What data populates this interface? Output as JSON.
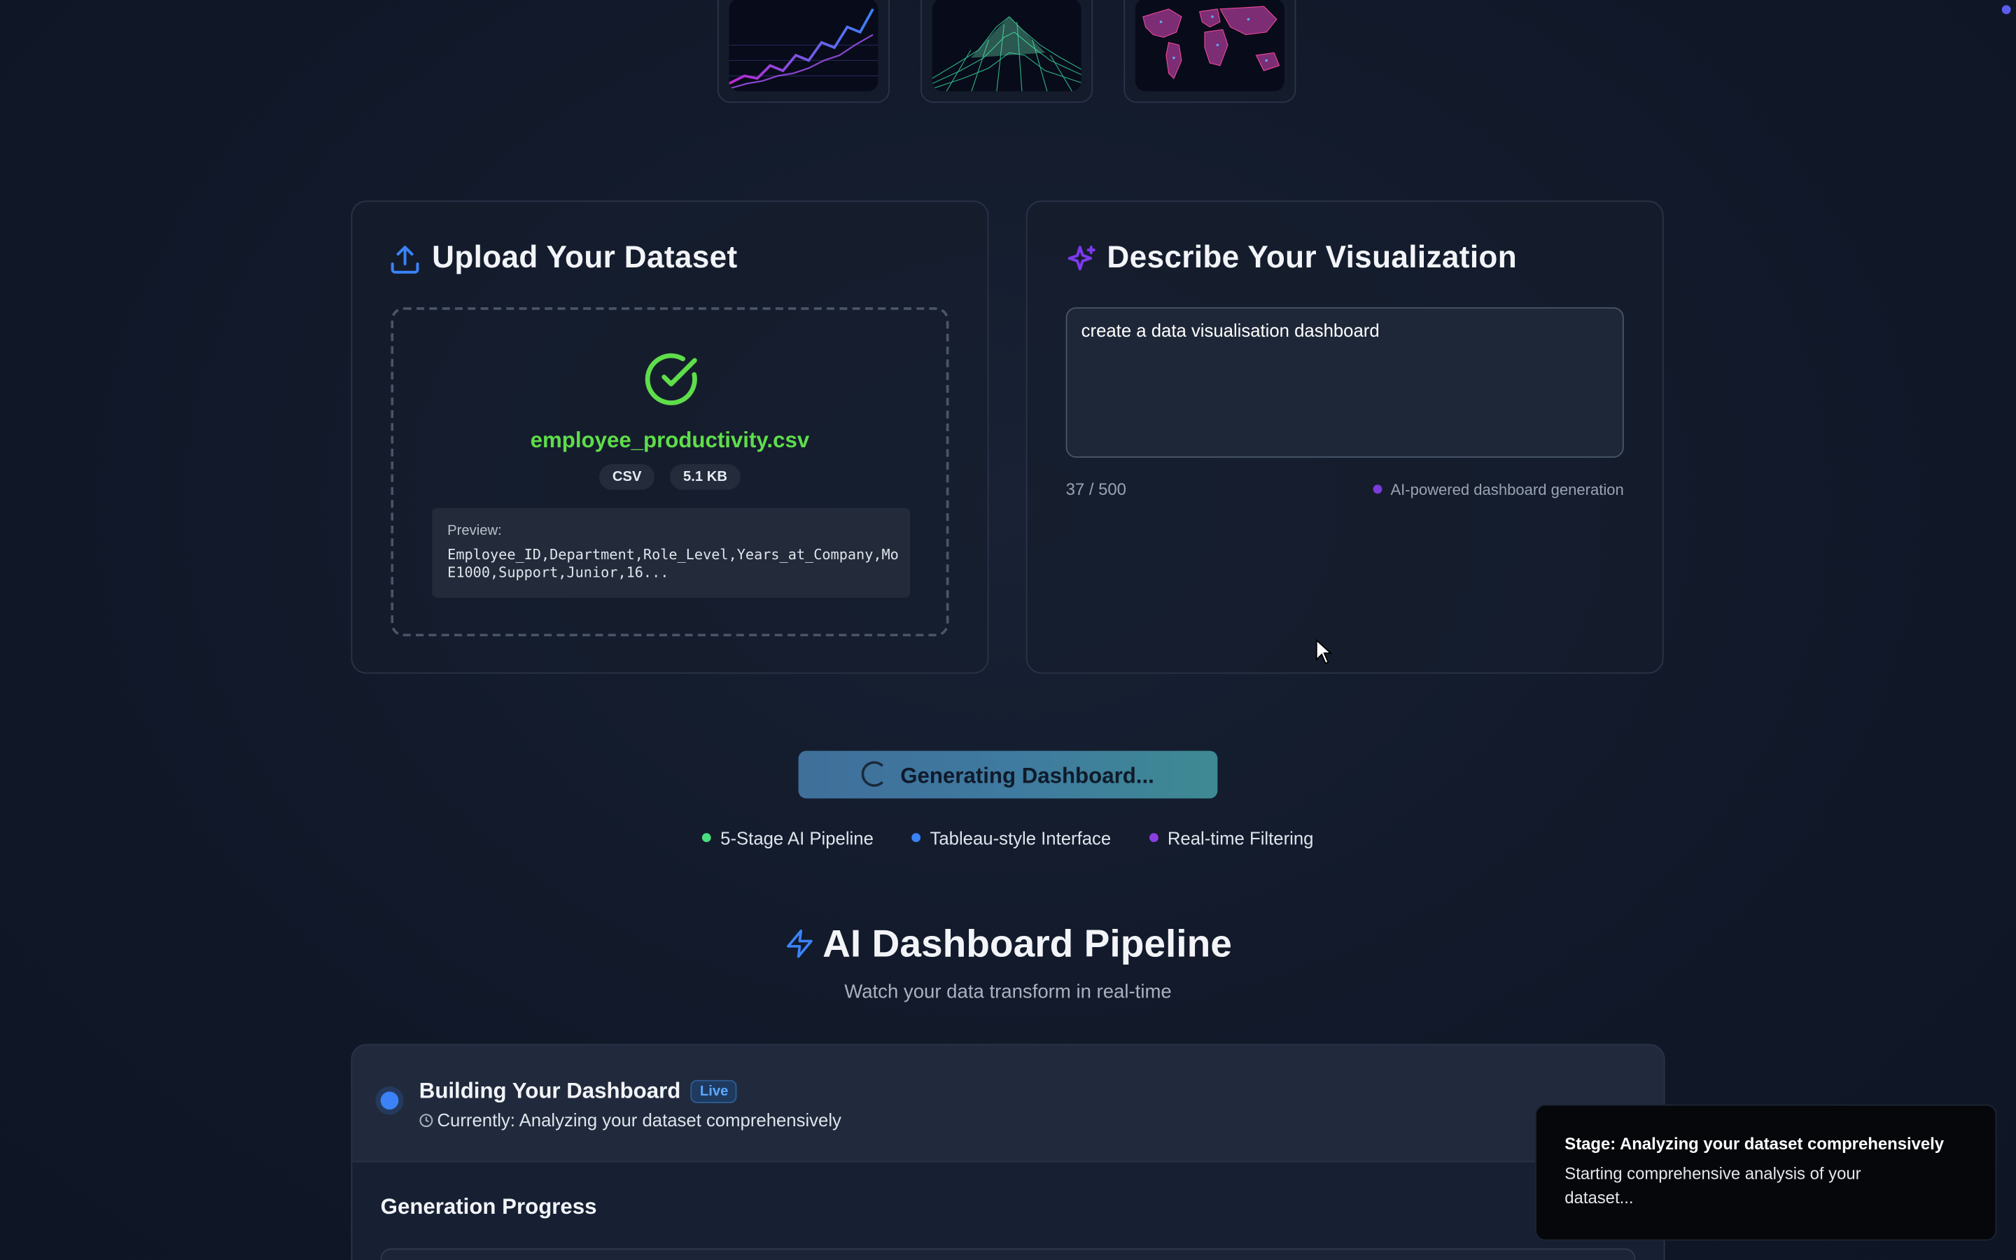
{
  "thumbnails": [
    {
      "name": "line-chart-thumbnail"
    },
    {
      "name": "terrain-3d-thumbnail"
    },
    {
      "name": "world-map-thumbnail"
    }
  ],
  "upload": {
    "title": "Upload Your Dataset",
    "icon": "upload-icon",
    "file_name": "employee_productivity.csv",
    "file_type": "CSV",
    "file_size": "5.1 KB",
    "preview_label": "Preview:",
    "preview_lines": [
      "Employee_ID,Department,Role_Level,Years_at_Company,Mo",
      "E1000,Support,Junior,16..."
    ]
  },
  "describe": {
    "title": "Describe Your Visualization",
    "icon": "sparkles-icon",
    "prompt_value": "create a data visualisation dashboard",
    "char_count": "37 / 500",
    "ai_note": "AI-powered dashboard generation"
  },
  "generate_button": {
    "label": "Generating Dashboard..."
  },
  "features": [
    {
      "label": "5-Stage AI Pipeline",
      "color": "#4ade80"
    },
    {
      "label": "Tableau-style Interface",
      "color": "#3b82f6"
    },
    {
      "label": "Real-time Filtering",
      "color": "#8b3fe0"
    }
  ],
  "pipeline": {
    "title": "AI Dashboard Pipeline",
    "subtitle": "Watch your data transform in real-time",
    "status_title": "Building Your Dashboard",
    "live_badge": "Live",
    "current_step": "Currently: Analyzing your dataset comprehensively",
    "progress_heading": "Generation Progress"
  },
  "toast": {
    "title": "Stage: Analyzing your dataset comprehensively",
    "body": "Starting comprehensive analysis of your dataset..."
  },
  "colors": {
    "success": "#5fdd4a",
    "accent_blue": "#3b82f6",
    "accent_purple": "#7c3aed"
  }
}
